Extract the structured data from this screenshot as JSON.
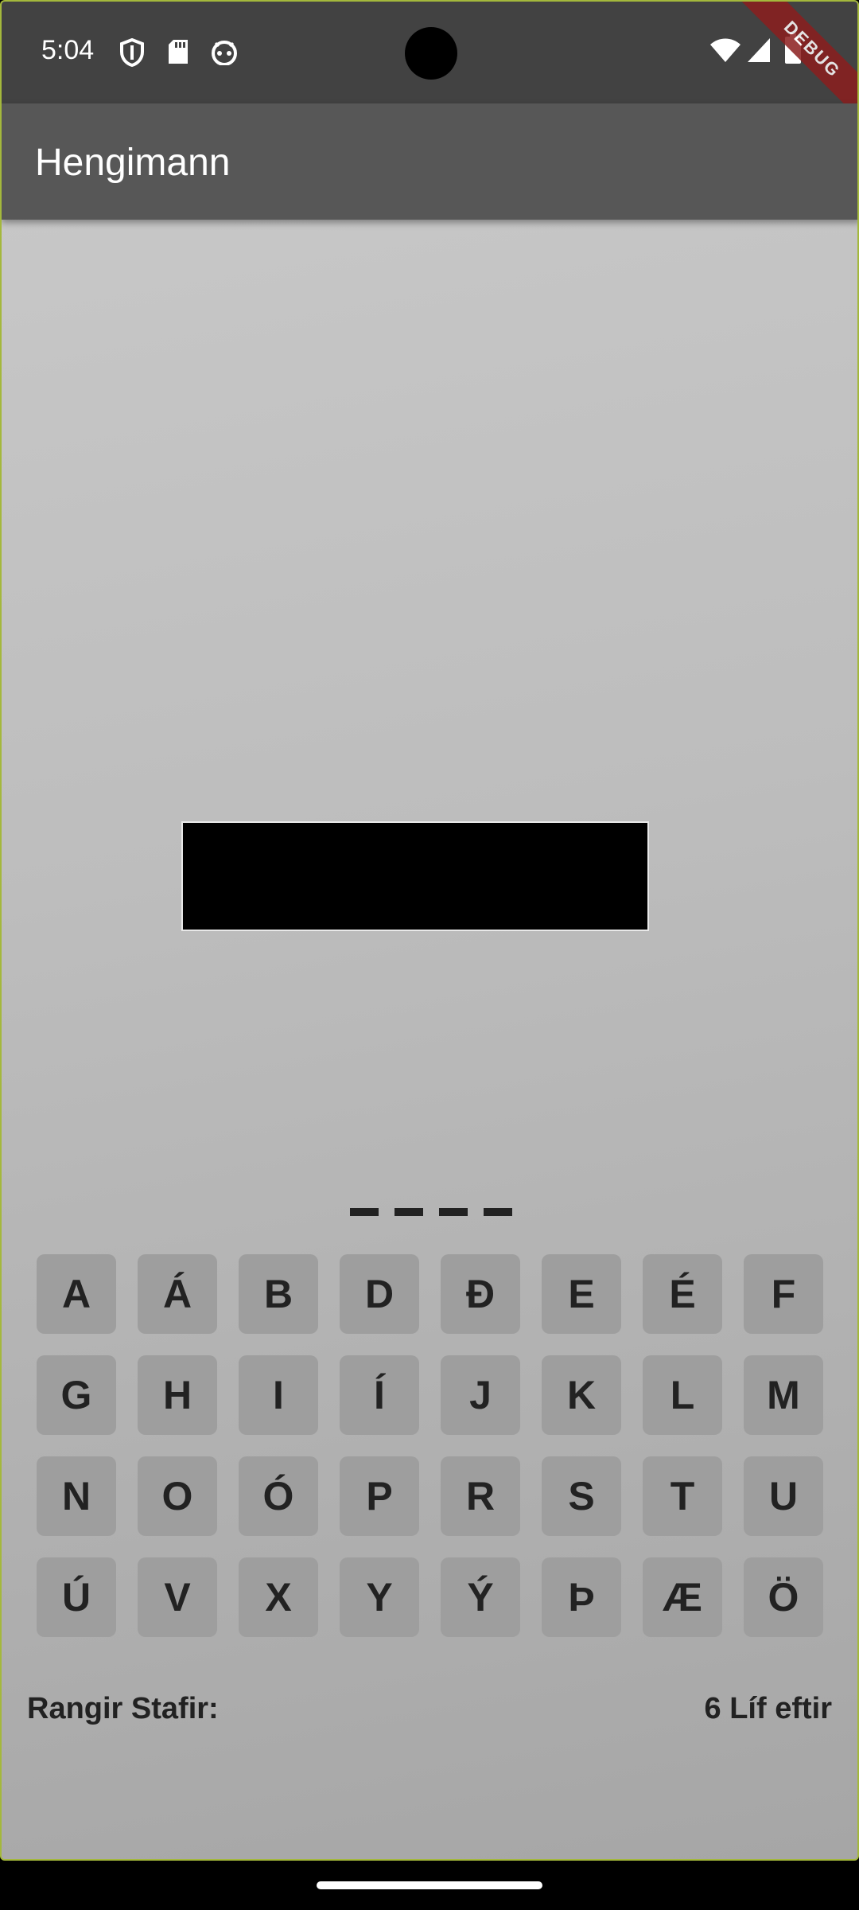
{
  "status_bar": {
    "time": "5:04",
    "left_icons": [
      "shield-icon",
      "sd-card-icon",
      "robot-face-icon"
    ],
    "right_icons": [
      "wifi-icon",
      "cellular-signal-icon",
      "battery-icon"
    ],
    "debug_banner": "DEBUG"
  },
  "app_bar": {
    "title": "Hengimann"
  },
  "game": {
    "word_slots": [
      "",
      "",
      "",
      ""
    ],
    "keyboard": [
      "A",
      "Á",
      "B",
      "D",
      "Ð",
      "E",
      "É",
      "F",
      "G",
      "H",
      "I",
      "Í",
      "J",
      "K",
      "L",
      "M",
      "N",
      "O",
      "Ó",
      "P",
      "R",
      "S",
      "T",
      "U",
      "Ú",
      "V",
      "X",
      "Y",
      "Ý",
      "Þ",
      "Æ",
      "Ö"
    ],
    "wrong_label": "Rangir Stafir:",
    "wrong_letters": "",
    "lives_text": "6 Líf eftir"
  },
  "colors": {
    "status_bar": "#424242",
    "app_bar": "#575757",
    "key_background": "#9e9e9e",
    "text": "#222222",
    "debug_ribbon": "#8b1e1e"
  }
}
